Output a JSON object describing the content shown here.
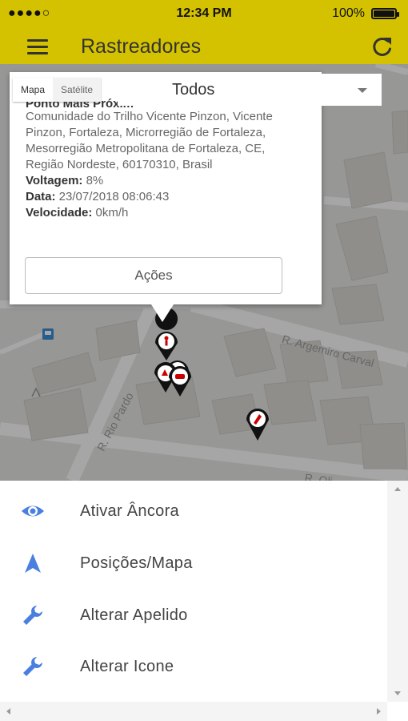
{
  "status": {
    "carrier": "●●●●○ ",
    "time": "12:34 PM",
    "battery": "100%",
    "battery_level": 1.0
  },
  "app": {
    "title": "Rastreadores",
    "accent": "#d4c200"
  },
  "map": {
    "map_type": {
      "mapa": "Mapa",
      "satelite": "Satélite"
    },
    "filter": {
      "selected": "Todos"
    },
    "streets": [
      "R. Argemiro Carval",
      "R. Rio Pardo",
      "R. Oli"
    ],
    "info": {
      "heading": "Ponto Mais Próxim",
      "address": "Comunidade do Trilho Vicente Pinzon, Vicente Pinzon, Fortaleza, Microrregião de Fortaleza, Mesorregião Metropolitana de Fortaleza, CE, Região Nordeste, 60170310, Brasil",
      "voltagem_label": "Voltagem:",
      "voltagem": " 8%",
      "data_label": "Data:",
      "data": " 23/07/2018 08:06:43",
      "velocidade_label": "Velocidade:",
      "velocidade": " 0km/h",
      "acoes": "Ações"
    }
  },
  "sheet": {
    "items": [
      {
        "label": "Ativar Âncora",
        "icon": "eye-icon"
      },
      {
        "label": "Posições/Mapa",
        "icon": "navigation-arrow-icon"
      },
      {
        "label": "Alterar Apelido",
        "icon": "wrench-icon"
      },
      {
        "label": "Alterar Icone",
        "icon": "wrench-icon"
      }
    ],
    "icon_color": "#4a7fe0"
  }
}
